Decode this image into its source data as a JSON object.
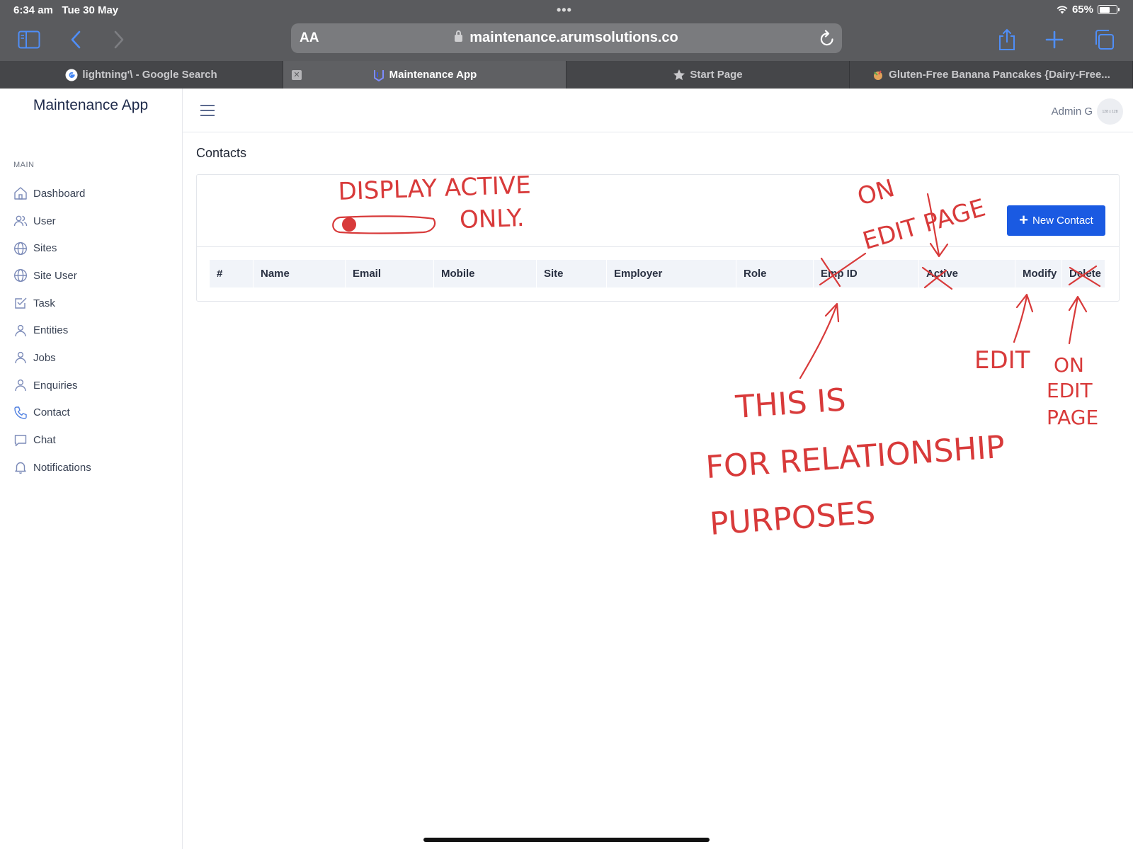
{
  "status_bar": {
    "time": "6:34 am",
    "date": "Tue 30 May",
    "battery_percent": "65%",
    "battery_level": 0.65
  },
  "browser": {
    "address_aa": "AA",
    "url": "maintenance.arumsolutions.co",
    "tabs": [
      {
        "title": "lightning'\\ - Google Search",
        "icon": "google-icon"
      },
      {
        "title": "Maintenance App",
        "icon": "app-logo-icon",
        "active": true
      },
      {
        "title": "Start Page",
        "icon": "star-icon"
      },
      {
        "title": "Gluten-Free Banana Pancakes {Dairy-Free...",
        "icon": "food-icon"
      }
    ]
  },
  "app": {
    "brand": "Maintenance App",
    "sidebar": {
      "section": "MAIN",
      "items": [
        {
          "label": "Dashboard",
          "icon": "home-icon"
        },
        {
          "label": "User",
          "icon": "users-icon"
        },
        {
          "label": "Sites",
          "icon": "globe-icon"
        },
        {
          "label": "Site User",
          "icon": "globe-icon"
        },
        {
          "label": "Task",
          "icon": "checkbox-icon"
        },
        {
          "label": "Entities",
          "icon": "person-icon"
        },
        {
          "label": "Jobs",
          "icon": "person-icon"
        },
        {
          "label": "Enquiries",
          "icon": "person-icon"
        },
        {
          "label": "Contact",
          "icon": "phone-icon"
        },
        {
          "label": "Chat",
          "icon": "chat-icon"
        },
        {
          "label": "Notifications",
          "icon": "bell-icon"
        }
      ]
    },
    "header": {
      "user_name": "Admin G",
      "avatar_text": "128 x 128"
    },
    "page_title": "Contacts",
    "new_contact_button": "New Contact",
    "table": {
      "columns": [
        "#",
        "Name",
        "Email",
        "Mobile",
        "Site",
        "Employer",
        "Role",
        "Emp ID",
        "Active",
        "Modify",
        "Delete"
      ]
    },
    "accent_color": "#1a5ae2"
  },
  "annotations": {
    "color": "#d83a3a",
    "notes": [
      "DISPLAY ACTIVE ONLY.",
      "ON EDIT PAGE",
      "THIS IS FOR RELATIONSHIP PURPOSES",
      "EDIT",
      "ON EDIT PAGE"
    ]
  }
}
